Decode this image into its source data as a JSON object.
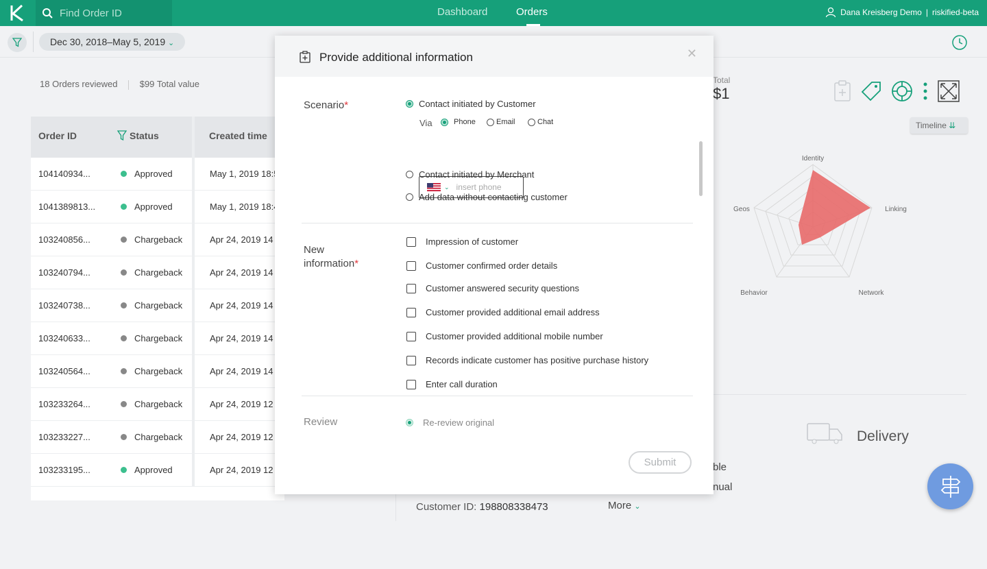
{
  "topbar": {
    "search_placeholder": "Find Order ID",
    "nav": [
      "Dashboard",
      "Orders"
    ],
    "user_name": "Dana Kreisberg Demo",
    "account": "riskified-beta"
  },
  "subbar": {
    "date_range": "Dec 30, 2018–May 5, 2019"
  },
  "summary": {
    "orders_count": "18",
    "orders_label": "Orders reviewed",
    "total_value": "$99",
    "total_label": "Total value"
  },
  "table": {
    "headers": [
      "Order ID",
      "Status",
      "Created time"
    ],
    "rows": [
      {
        "id": "104140934...",
        "status": "Approved",
        "time": "May 1, 2019 18:5",
        "color": "#3cbf8e"
      },
      {
        "id": "1041389813...",
        "status": "Approved",
        "time": "May 1, 2019 18:4",
        "color": "#3cbf8e"
      },
      {
        "id": "103240856...",
        "status": "Chargeback",
        "time": "Apr 24, 2019 14",
        "color": "#888888"
      },
      {
        "id": "103240794...",
        "status": "Chargeback",
        "time": "Apr 24, 2019 14",
        "color": "#888888"
      },
      {
        "id": "103240738...",
        "status": "Chargeback",
        "time": "Apr 24, 2019 14",
        "color": "#888888"
      },
      {
        "id": "103240633...",
        "status": "Chargeback",
        "time": "Apr 24, 2019 14",
        "color": "#888888"
      },
      {
        "id": "103240564...",
        "status": "Chargeback",
        "time": "Apr 24, 2019 14",
        "color": "#888888"
      },
      {
        "id": "103233264...",
        "status": "Chargeback",
        "time": "Apr 24, 2019 12",
        "color": "#888888"
      },
      {
        "id": "103233227...",
        "status": "Chargeback",
        "time": "Apr 24, 2019 12",
        "color": "#888888"
      },
      {
        "id": "103233195...",
        "status": "Approved",
        "time": "Apr 24, 2019 12",
        "color": "#3cbf8e"
      }
    ]
  },
  "right": {
    "total_label": "Total",
    "total_value": "$1",
    "timeline_label": "Timeline",
    "radar_labels": [
      "Identity",
      "Linking",
      "Network",
      "Behavior",
      "Geos"
    ],
    "delivery_label": "Delivery",
    "partial_1": "ble",
    "partial_2": "nual",
    "customer_id_label": "Customer ID:",
    "customer_id": "198808338473",
    "more_label": "More"
  },
  "modal": {
    "title": "Provide additional information",
    "scenario_label": "Scenario",
    "scenario_options": [
      "Contact initiated by Customer",
      "Contact initiated by Merchant",
      "Add data without contacting customer"
    ],
    "via_label": "Via",
    "via_options": [
      "Phone",
      "Email",
      "Chat"
    ],
    "phone_placeholder": "insert phone",
    "new_info_label_1": "New",
    "new_info_label_2": "information",
    "new_info_options": [
      "Impression of customer",
      "Customer confirmed order details",
      "Customer answered security questions",
      "Customer provided additional email address",
      "Customer provided additional mobile number",
      "Records indicate customer has positive purchase history",
      "Enter call duration"
    ],
    "review_label": "Review",
    "review_option": "Re-review original",
    "submit_label": "Submit",
    "required_mark": "*"
  }
}
